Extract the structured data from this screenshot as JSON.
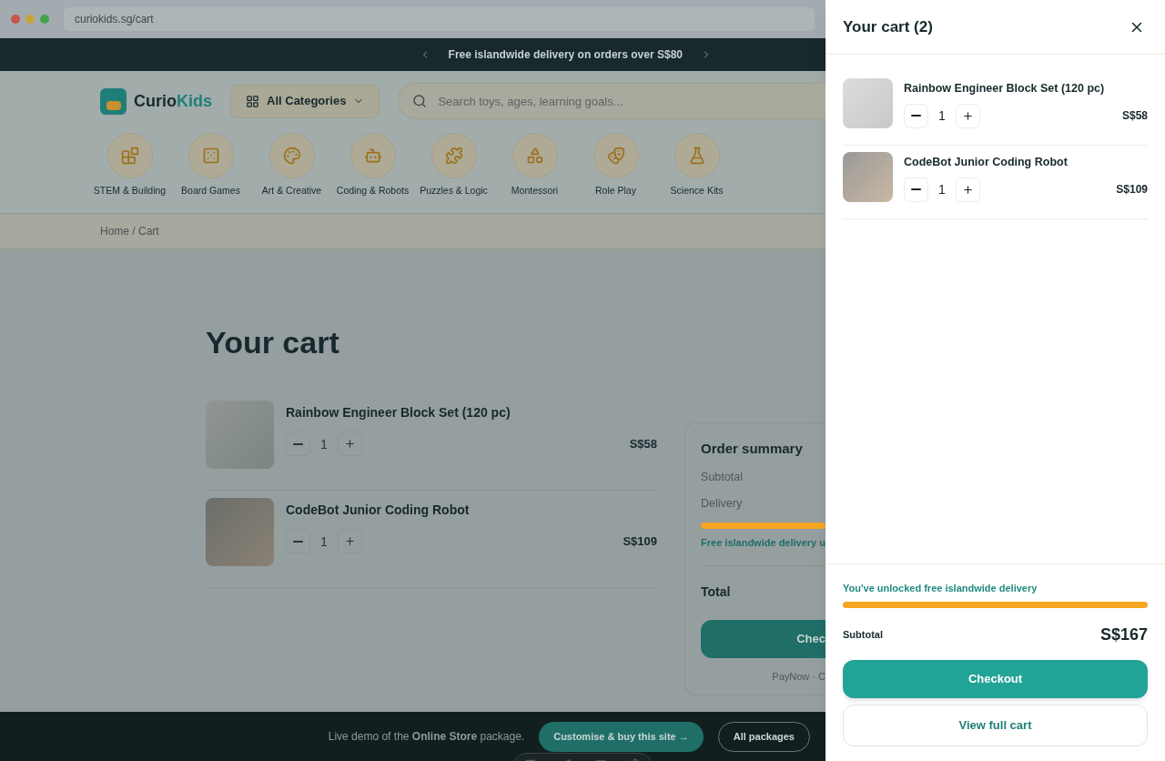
{
  "browser": {
    "url": "curiokids.sg/cart"
  },
  "announcement": {
    "text": "Free islandwide delivery on orders over S$80"
  },
  "header": {
    "logo": {
      "first": "Curio",
      "second": "Kids"
    },
    "categories_button": "All Categories",
    "search": {
      "placeholder": "Search toys, ages, learning goals..."
    }
  },
  "categories": [
    {
      "label": "STEM & Building"
    },
    {
      "label": "Board Games"
    },
    {
      "label": "Art & Creative"
    },
    {
      "label": "Coding & Robots"
    },
    {
      "label": "Puzzles & Logic"
    },
    {
      "label": "Montessori"
    },
    {
      "label": "Role Play"
    },
    {
      "label": "Science Kits"
    }
  ],
  "breadcrumb": "Home / Cart",
  "cart_page": {
    "title": "Your cart",
    "items": [
      {
        "name": "Rainbow Engineer Block Set (120 pc)",
        "quantity": "1",
        "price": "S$58"
      },
      {
        "name": "CodeBot Junior Coding Robot",
        "quantity": "1",
        "price": "S$109"
      }
    ],
    "summary": {
      "title": "Order summary",
      "rows": [
        {
          "label": "Subtotal"
        },
        {
          "label": "Delivery"
        }
      ],
      "progress": {
        "level": 1,
        "note": "Free islandwide delivery u"
      },
      "total_label": "Total",
      "checkout_button": "Chec",
      "payment_note": "PayNow · C"
    }
  },
  "drawer": {
    "title": "Your cart (2)",
    "items": [
      {
        "name": "Rainbow Engineer Block Set (120 pc)",
        "quantity": "1",
        "price": "S$58"
      },
      {
        "name": "CodeBot Junior Coding Robot",
        "quantity": "1",
        "price": "S$109"
      }
    ],
    "unlocked_note": "You've unlocked free islandwide delivery",
    "progress": {
      "level": 1
    },
    "subtotal_label": "Subtotal",
    "subtotal_value": "S$167",
    "checkout_button": "Checkout",
    "view_cart_button": "View full cart"
  },
  "footer": {
    "text": "Live demo of the **Online Store** package.",
    "cta_button": "Customise & buy this site →",
    "packages_button": "All packages"
  }
}
